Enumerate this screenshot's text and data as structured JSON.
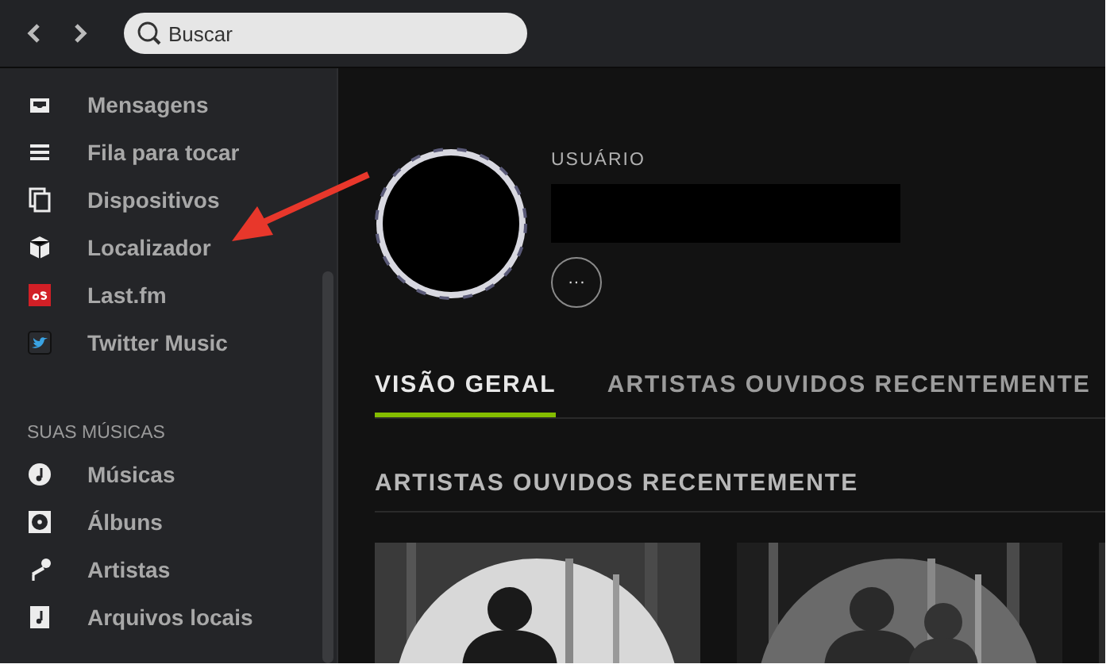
{
  "search": {
    "placeholder": "Buscar"
  },
  "sidebar": {
    "items": [
      {
        "label": "Mensagens"
      },
      {
        "label": "Fila para tocar"
      },
      {
        "label": "Dispositivos"
      },
      {
        "label": "Localizador"
      },
      {
        "label": "Last.fm"
      },
      {
        "label": "Twitter Music"
      }
    ],
    "section": {
      "title": "SUAS MÚSICAS",
      "items": [
        {
          "label": "Músicas"
        },
        {
          "label": "Álbuns"
        },
        {
          "label": "Artistas"
        },
        {
          "label": "Arquivos locais"
        }
      ]
    }
  },
  "profile": {
    "type_label": "USUÁRIO",
    "more_button": "···"
  },
  "tabs": [
    {
      "label": "VISÃO GERAL",
      "selected": true
    },
    {
      "label": "ARTISTAS OUVIDOS RECENTEMENTE",
      "selected": false
    }
  ],
  "section": {
    "title": "ARTISTAS OUVIDOS RECENTEMENTE"
  }
}
